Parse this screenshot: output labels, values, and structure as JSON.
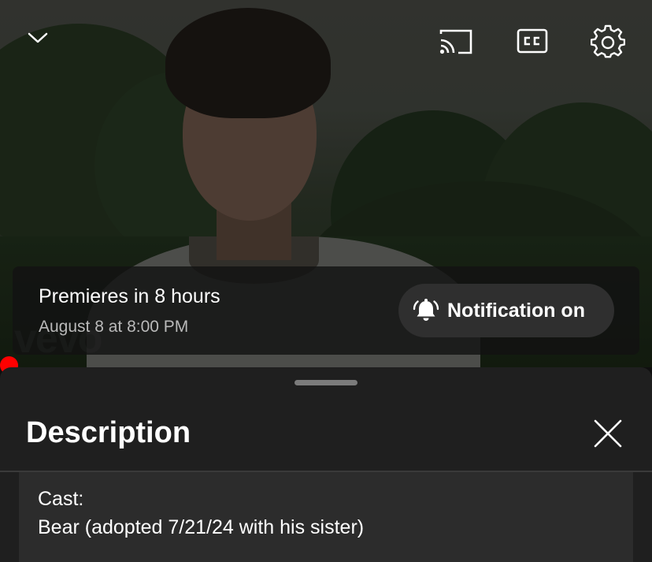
{
  "video": {
    "watermark": "vevo",
    "icons": [
      "chevron-down-icon",
      "cast-icon",
      "closed-captions-icon",
      "settings-gear-icon"
    ]
  },
  "premiere": {
    "title": "Premieres in 8 hours",
    "date": "August 8 at 8:00 PM",
    "notification_label": "Notification on"
  },
  "description": {
    "title": "Description",
    "lines": [
      "Cast:",
      "Bear (adopted 7/21/24 with his sister)"
    ]
  },
  "colors": {
    "progress_dot": "#ff0000",
    "sheet_background": "#1f1f1f",
    "button_background": "#2f2f2f"
  }
}
